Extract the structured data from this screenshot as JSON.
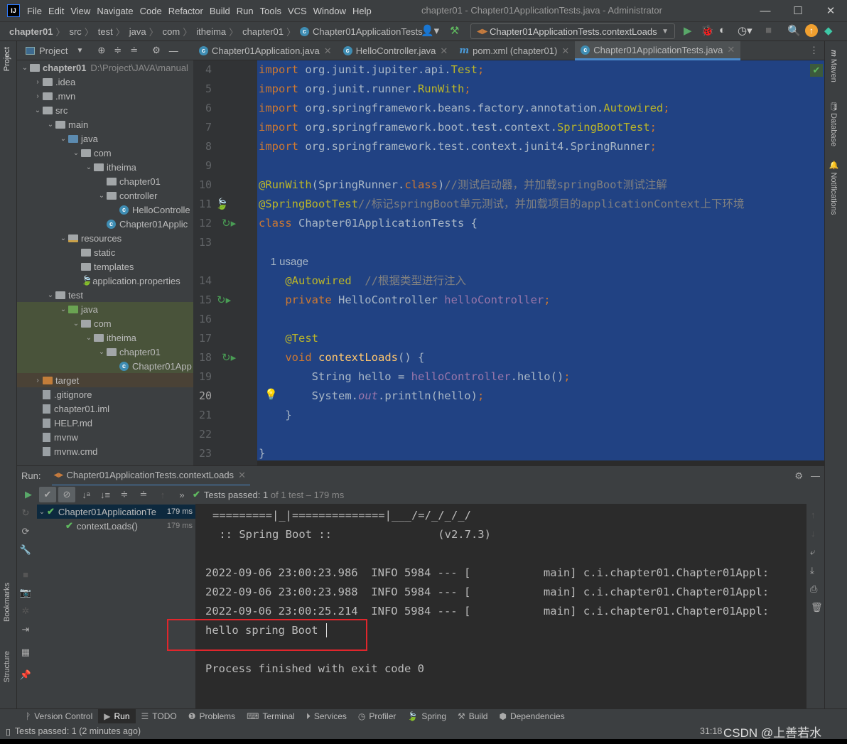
{
  "window": {
    "title": "chapter01 - Chapter01ApplicationTests.java - Administrator",
    "logo": "IJ"
  },
  "menu": [
    "File",
    "Edit",
    "View",
    "Navigate",
    "Code",
    "Refactor",
    "Build",
    "Run",
    "Tools",
    "VCS",
    "Window",
    "Help"
  ],
  "breadcrumb": [
    "chapter01",
    "src",
    "test",
    "java",
    "com",
    "itheima",
    "chapter01",
    "Chapter01ApplicationTests"
  ],
  "run_config": "Chapter01ApplicationTests.contextLoads",
  "project_panel": {
    "title": "Project",
    "stripe_label": "Project"
  },
  "tree": [
    {
      "d": 0,
      "a": "v",
      "ic": "fold",
      "t": "chapter01",
      "bold": true,
      "path": "D:\\Project\\JAVA\\manual"
    },
    {
      "d": 1,
      "a": ">",
      "ic": "fold",
      "t": ".idea"
    },
    {
      "d": 1,
      "a": ">",
      "ic": "fold",
      "t": ".mvn"
    },
    {
      "d": 1,
      "a": "v",
      "ic": "fold",
      "t": "src"
    },
    {
      "d": 2,
      "a": "v",
      "ic": "fold",
      "t": "main"
    },
    {
      "d": 3,
      "a": "v",
      "ic": "fold src",
      "t": "java"
    },
    {
      "d": 4,
      "a": "v",
      "ic": "fold pkg",
      "t": "com"
    },
    {
      "d": 5,
      "a": "v",
      "ic": "fold pkg",
      "t": "itheima"
    },
    {
      "d": 6,
      "a": "",
      "ic": "fold pkg",
      "t": "chapter01"
    },
    {
      "d": 6,
      "a": "v",
      "ic": "fold pkg",
      "t": "controller"
    },
    {
      "d": 7,
      "a": "",
      "ic": "cls",
      "t": "HelloControlle"
    },
    {
      "d": 6,
      "a": "",
      "ic": "cls",
      "t": "Chapter01Applic"
    },
    {
      "d": 3,
      "a": "v",
      "ic": "fold res",
      "t": "resources"
    },
    {
      "d": 4,
      "a": "",
      "ic": "fold",
      "t": "static"
    },
    {
      "d": 4,
      "a": "",
      "ic": "fold",
      "t": "templates"
    },
    {
      "d": 4,
      "a": "",
      "ic": "leaf",
      "t": "application.properties"
    },
    {
      "d": 2,
      "a": "v",
      "ic": "fold",
      "t": "test"
    },
    {
      "d": 3,
      "a": "v",
      "ic": "fold tst",
      "t": "java",
      "hl": "test"
    },
    {
      "d": 4,
      "a": "v",
      "ic": "fold pkg",
      "t": "com",
      "hl": "test"
    },
    {
      "d": 5,
      "a": "v",
      "ic": "fold pkg",
      "t": "itheima",
      "hl": "test"
    },
    {
      "d": 6,
      "a": "v",
      "ic": "fold pkg",
      "t": "chapter01",
      "hl": "test"
    },
    {
      "d": 7,
      "a": "",
      "ic": "cls",
      "t": "Chapter01App",
      "hl": "test"
    },
    {
      "d": 1,
      "a": ">",
      "ic": "fold exc",
      "t": "target",
      "hl": "excl"
    },
    {
      "d": 1,
      "a": "",
      "ic": "file",
      "t": ".gitignore"
    },
    {
      "d": 1,
      "a": "",
      "ic": "file",
      "t": "chapter01.iml"
    },
    {
      "d": 1,
      "a": "",
      "ic": "file",
      "t": "HELP.md"
    },
    {
      "d": 1,
      "a": "",
      "ic": "file",
      "t": "mvnw"
    },
    {
      "d": 1,
      "a": "",
      "ic": "file",
      "t": "mvnw.cmd"
    }
  ],
  "editor_tabs": [
    {
      "label": "Chapter01Application.java",
      "icon": "class"
    },
    {
      "label": "HelloController.java",
      "icon": "class"
    },
    {
      "label": "pom.xml (chapter01)",
      "icon": "maven"
    },
    {
      "label": "Chapter01ApplicationTests.java",
      "icon": "class",
      "active": true
    }
  ],
  "code": [
    {
      "n": "4",
      "tk": [
        [
          "kw",
          "import "
        ],
        [
          "",
          "org.junit.jupiter.api."
        ],
        [
          "ty",
          "Test"
        ],
        [
          "kw",
          ";"
        ]
      ]
    },
    {
      "n": "5",
      "tk": [
        [
          "kw",
          "import "
        ],
        [
          "",
          "org.junit.runner."
        ],
        [
          "ty",
          "RunWith"
        ],
        [
          "kw",
          ";"
        ]
      ]
    },
    {
      "n": "6",
      "tk": [
        [
          "kw",
          "import "
        ],
        [
          "",
          "org.springframework.beans.factory.annotation."
        ],
        [
          "ty",
          "Autowired"
        ],
        [
          "kw",
          ";"
        ]
      ]
    },
    {
      "n": "7",
      "tk": [
        [
          "kw",
          "import "
        ],
        [
          "",
          "org.springframework.boot.test.context."
        ],
        [
          "ty",
          "SpringBootTest"
        ],
        [
          "kw",
          ";"
        ]
      ]
    },
    {
      "n": "8",
      "tk": [
        [
          "kw",
          "import "
        ],
        [
          "",
          "org.springframework.test.context.junit4.SpringRunner"
        ],
        [
          "kw",
          ";"
        ]
      ]
    },
    {
      "n": "9",
      "tk": []
    },
    {
      "n": "10",
      "tk": [
        [
          "an",
          "@RunWith"
        ],
        [
          "",
          "(SpringRunner."
        ],
        [
          "kw",
          "class"
        ],
        [
          "",
          ")"
        ],
        [
          "cm",
          "//测试启动器，并加载springBoot测试注解"
        ]
      ]
    },
    {
      "n": "11",
      "tk": [
        [
          "an",
          "@SpringBootTest"
        ],
        [
          "cm",
          "//标记springBoot单元测试，并加载项目的applicationContext上下环境"
        ]
      ]
    },
    {
      "n": "12",
      "tk": [
        [
          "kw",
          "class "
        ],
        [
          "",
          "Chapter01ApplicationTests {"
        ]
      ]
    },
    {
      "n": "13",
      "tk": []
    },
    {
      "n": "",
      "tk": [
        [
          "hint",
          "    1 usage"
        ]
      ]
    },
    {
      "n": "14",
      "tk": [
        [
          "an",
          "    @Autowired"
        ],
        [
          "cm",
          "  //根据类型进行注入"
        ]
      ]
    },
    {
      "n": "15",
      "tk": [
        [
          "kw",
          "    private "
        ],
        [
          "",
          "HelloController "
        ],
        [
          "fd",
          "helloController"
        ],
        [
          "kw",
          ";"
        ]
      ]
    },
    {
      "n": "16",
      "tk": []
    },
    {
      "n": "17",
      "tk": [
        [
          "an",
          "    @Test"
        ]
      ]
    },
    {
      "n": "18",
      "tk": [
        [
          "kw",
          "    void "
        ],
        [
          "fn",
          "contextLoads"
        ],
        [
          "",
          "() {"
        ]
      ]
    },
    {
      "n": "19",
      "tk": [
        [
          "",
          "        String hello = "
        ],
        [
          "fd",
          "helloController"
        ],
        [
          "",
          ".hello()"
        ],
        [
          "kw",
          ";"
        ]
      ]
    },
    {
      "n": "20",
      "tk": [
        [
          "",
          "        System."
        ],
        [
          "it",
          "out"
        ],
        [
          "",
          ".println(hello)"
        ],
        [
          "kw",
          ";"
        ]
      ],
      "cur": true
    },
    {
      "n": "21",
      "tk": [
        [
          "",
          "    }"
        ]
      ]
    },
    {
      "n": "22",
      "tk": []
    },
    {
      "n": "23",
      "tk": [
        [
          "",
          "}"
        ]
      ]
    }
  ],
  "run": {
    "label": "Run:",
    "tab": "Chapter01ApplicationTests.contextLoads",
    "status_prefix": "Tests passed:",
    "status_count": "1",
    "status_suffix": "of 1 test – 179 ms",
    "tree": [
      {
        "label": "Chapter01ApplicationTe",
        "ms": "179 ms"
      },
      {
        "label": "contextLoads()",
        "ms": "179 ms"
      }
    ],
    "console": [
      "=========|_|==============|___/=/_/_/_/",
      " :: Spring Boot ::                (v2.7.3)",
      "",
      "2022-09-06 23:00:23.986  INFO 5984 --- [           main] c.i.chapter01.Chapter01Appl:",
      "2022-09-06 23:00:23.988  INFO 5984 --- [           main] c.i.chapter01.Chapter01Appl:",
      "2022-09-06 23:00:25.214  INFO 5984 --- [           main] c.i.chapter01.Chapter01Appl:",
      "hello spring Boot",
      "",
      "Process finished with exit code 0"
    ]
  },
  "right_stripe": [
    "Maven",
    "Database",
    "Notifications"
  ],
  "left_stripe_bottom": [
    "Bookmarks",
    "Structure"
  ],
  "bottom_tabs": [
    "Version Control",
    "Run",
    "TODO",
    "Problems",
    "Terminal",
    "Services",
    "Profiler",
    "Spring",
    "Build",
    "Dependencies"
  ],
  "status_bar": {
    "message": "Tests passed: 1 (2 minutes ago)",
    "position": "31:18",
    "watermark": "CSDN @上善若水"
  },
  "colors": {
    "selection": "#214283",
    "keyword": "#cc7832",
    "annotation": "#bbb529",
    "field": "#9876aa",
    "comment": "#808080",
    "highlight_box": "#e0262c",
    "pass": "#5fb85f"
  }
}
